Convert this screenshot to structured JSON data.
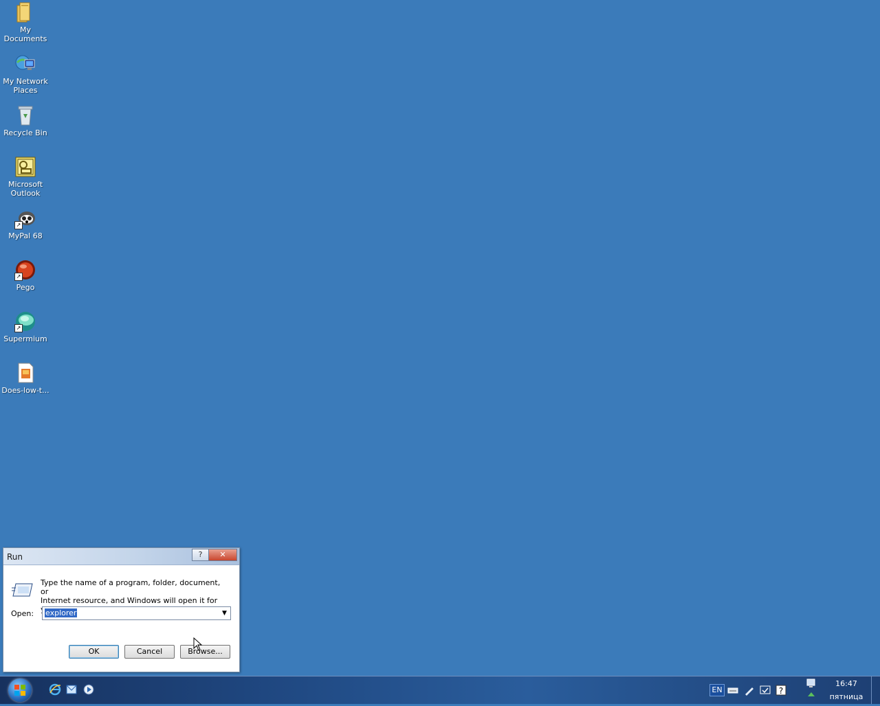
{
  "desktop": {
    "icons": [
      {
        "label_line1": "My",
        "label_line2": "Documents",
        "icon": "folder-icon"
      },
      {
        "label_line1": "My Network",
        "label_line2": "Places",
        "icon": "network-places-icon"
      },
      {
        "label_line1": "Recycle Bin",
        "label_line2": "",
        "icon": "recycle-bin-icon"
      },
      {
        "label_line1": "Microsoft",
        "label_line2": "Outlook",
        "icon": "outlook-icon"
      },
      {
        "label_line1": "MyPal 68",
        "label_line2": "",
        "icon": "mypal-icon"
      },
      {
        "label_line1": "Pego",
        "label_line2": "",
        "icon": "pego-icon"
      },
      {
        "label_line1": "Supermium",
        "label_line2": "",
        "icon": "supermium-icon"
      },
      {
        "label_line1": "Does-low-t...",
        "label_line2": "",
        "icon": "document-icon"
      }
    ]
  },
  "run_dialog": {
    "title": "Run",
    "help_label": "?",
    "close_label": "✕",
    "description_line1": "Type the name of a program, folder, document, or",
    "description_line2": "Internet resource, and Windows will open it for you.",
    "open_label": "Open:",
    "open_value": "explorer",
    "ok_label": "OK",
    "cancel_label": "Cancel",
    "browse_label": "Browse..."
  },
  "taskbar": {
    "quick_launch": [
      "internet-explorer-icon",
      "outlook-express-icon",
      "media-player-icon"
    ],
    "tray": {
      "language": "EN",
      "clock_time": "16:47",
      "clock_day": "пятница"
    }
  },
  "colors": {
    "desktop_background": "#3b7bba",
    "selection": "#3169c6",
    "close_button": "#c9462e"
  }
}
